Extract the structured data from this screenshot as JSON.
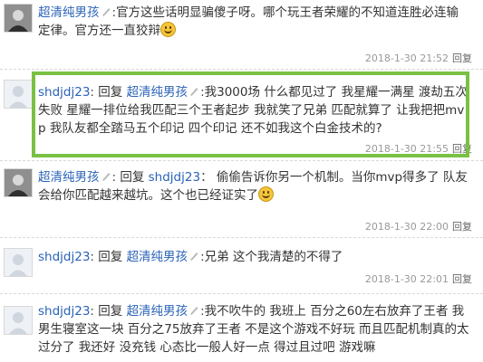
{
  "comments": [
    {
      "username": "超清纯男孩",
      "body": "官方这些话明显骗傻子呀。哪个玩王者荣耀的不知道连胜必连输定律。官方还一直狡辩",
      "time": "2018-1-30 21:52",
      "reply_label": "回复"
    },
    {
      "username": "shdjdj23",
      "reply_word": "回复",
      "reply_to": "超清纯男孩",
      "body": "我3000场 什么都见过了 我星耀一满星 渡劫五次失败 星耀一排位给我匹配三个王者起步 我就笑了兄弟 匹配就算了 让我把把mvp 我队友都全踏马五个印记 四个印记 还不如我这个白金技术的?",
      "time": "2018-1-30 21:55",
      "reply_label": "回复"
    },
    {
      "username": "超清纯男孩",
      "reply_word": "回复",
      "reply_to": "shdjdj23",
      "body": "偷偷告诉你另一个机制。当你mvp得多了 队友会给你匹配越来越坑。这个也已经证实了",
      "time": "2018-1-30 22:00",
      "reply_label": "回复"
    },
    {
      "username": "shdjdj23",
      "reply_word": "回复",
      "reply_to": "超清纯男孩",
      "body": "兄弟 这个我清楚的不得了",
      "time": "2018-1-30 22:01",
      "reply_label": "回复"
    },
    {
      "username": "shdjdj23",
      "reply_word": "回复",
      "reply_to": "超清纯男孩",
      "body": "我不吹牛的 我班上 百分之60左右放弃了王者 我男生寝室这一块 百分之75放弃了王者 不是这个游戏不好玩 而且匹配机制真的太过分了 我还好 没充钱 心态比一般人好一点 得过且过吧 游戏嘛"
    }
  ],
  "colors": {
    "highlight": "#7ac143",
    "username": "#2a63b8"
  }
}
